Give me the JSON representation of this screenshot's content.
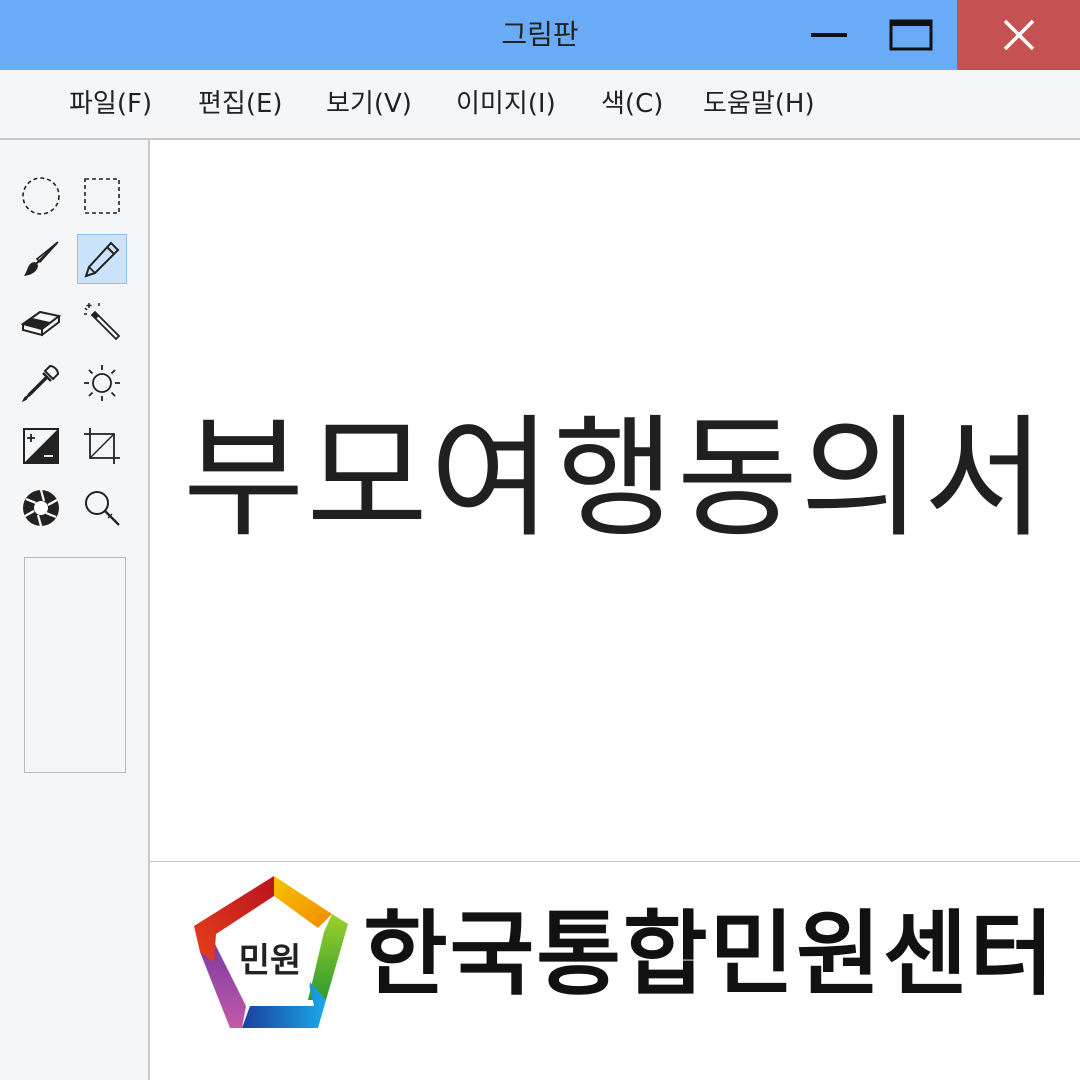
{
  "window": {
    "title": "그림판"
  },
  "menu": [
    {
      "label": "파일(F)",
      "name": "menu-file"
    },
    {
      "label": "편집(E)",
      "name": "menu-edit"
    },
    {
      "label": "보기(V)",
      "name": "menu-view"
    },
    {
      "label": "이미지(I)",
      "name": "menu-image"
    },
    {
      "label": "색(C)",
      "name": "menu-color"
    },
    {
      "label": "도움말(H)",
      "name": "menu-help"
    }
  ],
  "tools": [
    {
      "icon": "ellipse-select-icon",
      "selected": false
    },
    {
      "icon": "rect-select-icon",
      "selected": false
    },
    {
      "icon": "brush-icon",
      "selected": false
    },
    {
      "icon": "pencil-icon",
      "selected": true
    },
    {
      "icon": "eraser-icon",
      "selected": false
    },
    {
      "icon": "magic-wand-icon",
      "selected": false
    },
    {
      "icon": "eyedropper-icon",
      "selected": false
    },
    {
      "icon": "brightness-icon",
      "selected": false
    },
    {
      "icon": "contrast-icon",
      "selected": false
    },
    {
      "icon": "crop-icon",
      "selected": false
    },
    {
      "icon": "aperture-icon",
      "selected": false
    },
    {
      "icon": "magnifier-icon",
      "selected": false
    }
  ],
  "canvas": {
    "document_title": "부모여행동의서",
    "logo_text": "민원",
    "brand_name": "한국통합민원센터"
  },
  "colors": {
    "titlebar": "#6aabf7",
    "close_button": "#c65152",
    "selected_tool": "#cce4fb"
  }
}
